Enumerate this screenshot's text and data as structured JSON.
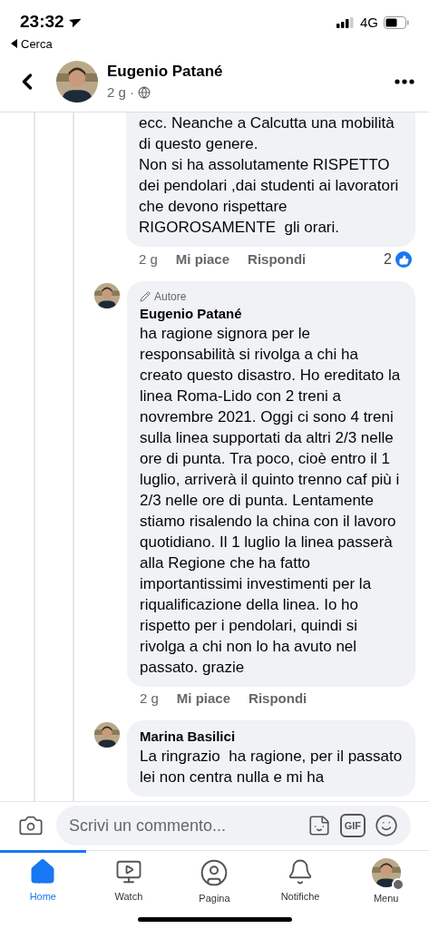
{
  "status_bar": {
    "time": "23:32",
    "back_app": "Cerca",
    "network": "4G"
  },
  "header": {
    "name": "Eugenio Patané",
    "meta": "2 g ·"
  },
  "comments": [
    {
      "kind": "continued",
      "paragraphs": [
        "ecc. Neanche a Calcutta una mobilità di questo genere.",
        "Non si ha assolutamente RISPETTO dei pendolari ,dai studenti ai lavoratori che devono rispettare RIGOROSAMENTE  gli orari."
      ],
      "actions": {
        "time": "2 g",
        "like": "Mi piace",
        "reply": "Rispondi",
        "reactions": "2"
      }
    },
    {
      "kind": "reply",
      "badge": "Autore",
      "author": "Eugenio Patané",
      "paragraphs": [
        "ha ragione signora per le responsabilità si rivolga a chi ha creato questo disastro. Ho ereditato la linea Roma-Lido con 2 treni a novrembre 2021. Oggi ci sono 4 treni sulla linea supportati da altri 2/3 nelle ore di punta. Tra poco, cioè entro il 1 luglio, arriverà il quinto trenno caf più i 2/3 nelle ore di punta. Lentamente stiamo risalendo la china con il lavoro quotidiano. Il 1 luglio la linea passerà alla Regione che ha fatto importantissimi investimenti per la riqualificazione della linea. Io ho rispetto per i pendolari, quindi si rivolga a chi non lo ha avuto nel passato. grazie"
      ],
      "actions": {
        "time": "2 g",
        "like": "Mi piace",
        "reply": "Rispondi"
      }
    },
    {
      "kind": "reply",
      "author": "Marina Basilici",
      "paragraphs": [
        "La ringrazio  ha ragione, per il passato lei non centra nulla e mi ha"
      ]
    }
  ],
  "composer": {
    "placeholder": "Scrivi un commento...",
    "gif": "GIF"
  },
  "tabs": [
    {
      "label": "Home",
      "kind": "home",
      "selected": true
    },
    {
      "label": "Watch",
      "kind": "watch",
      "selected": false
    },
    {
      "label": "Pagina",
      "kind": "page",
      "selected": false
    },
    {
      "label": "Notifiche",
      "kind": "bell",
      "selected": false
    },
    {
      "label": "Menu",
      "kind": "menu",
      "selected": false
    }
  ]
}
